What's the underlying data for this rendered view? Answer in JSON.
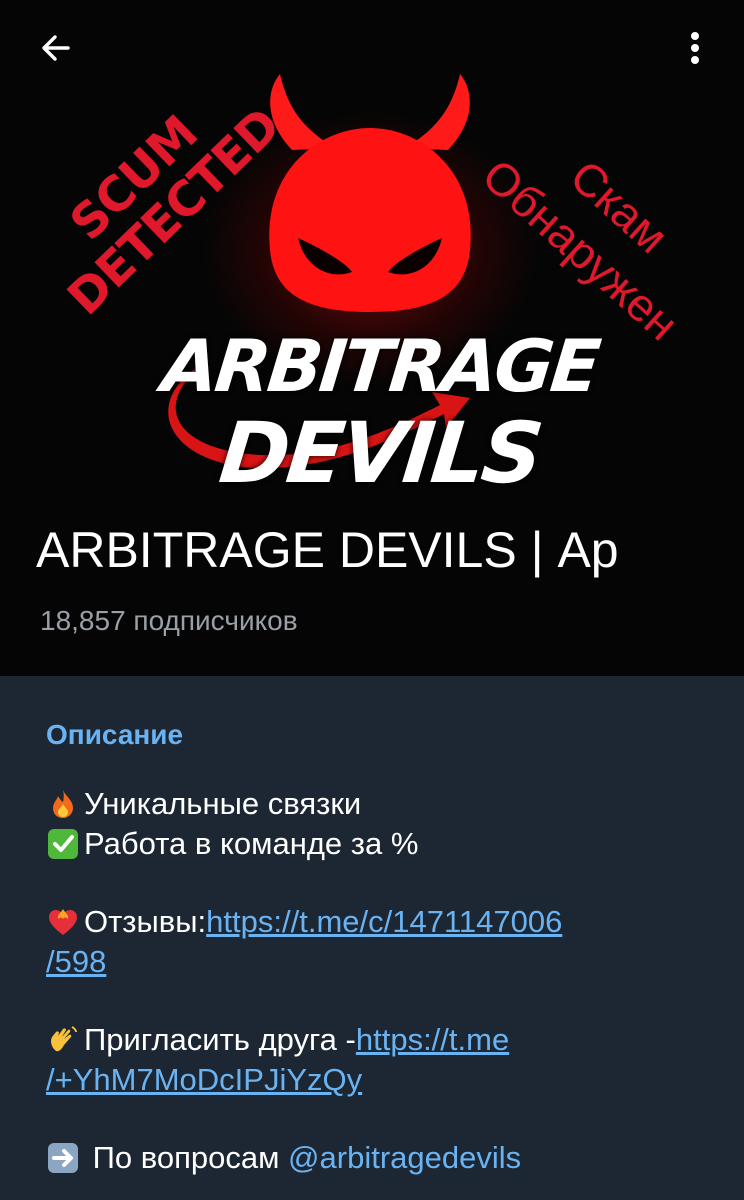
{
  "header": {
    "back_icon": "arrow-left-icon",
    "menu_icon": "more-vertical-icon",
    "channel_title": "ARBITRAGE DEVILS | Ар",
    "subscribers": "18,857 подписчиков",
    "avatar": {
      "logo_line1": "ARBITRAGE",
      "logo_line2": "DEVILS",
      "stamp_en_line1": "SCUM",
      "stamp_en_line2": "DETECTED",
      "stamp_ru_line1": "Скам",
      "stamp_ru_line2": "Обнаружен"
    }
  },
  "info": {
    "section_label": "Описание",
    "lines": {
      "line1_icon": "fire-emoji",
      "line1_text": "Уникальные связки",
      "line2_icon": "check-mark-button-emoji",
      "line2_text": "Работа в команде за %",
      "line3_icon": "heart-on-fire-emoji",
      "line3_text": "Отзывы: ",
      "line3_link_a": "https://t.me/c/1471147006",
      "line3_link_b": "/598",
      "line4_icon": "waving-hand-emoji",
      "line4_text": "Пригласить друга - ",
      "line4_link_a": "https://t.me",
      "line4_link_b": "/+YhM7MoDcIPJiYzQy",
      "line5_icon": "right-arrow-emoji",
      "line5_text": " По вопросам ",
      "line5_link": "@arbitragedevils"
    }
  },
  "colors": {
    "header_bg": "#050505",
    "panel_bg": "#1d2733",
    "accent": "#6ab3f3",
    "stamp_red": "#e0182b",
    "devil_red": "#ff1a1a"
  }
}
